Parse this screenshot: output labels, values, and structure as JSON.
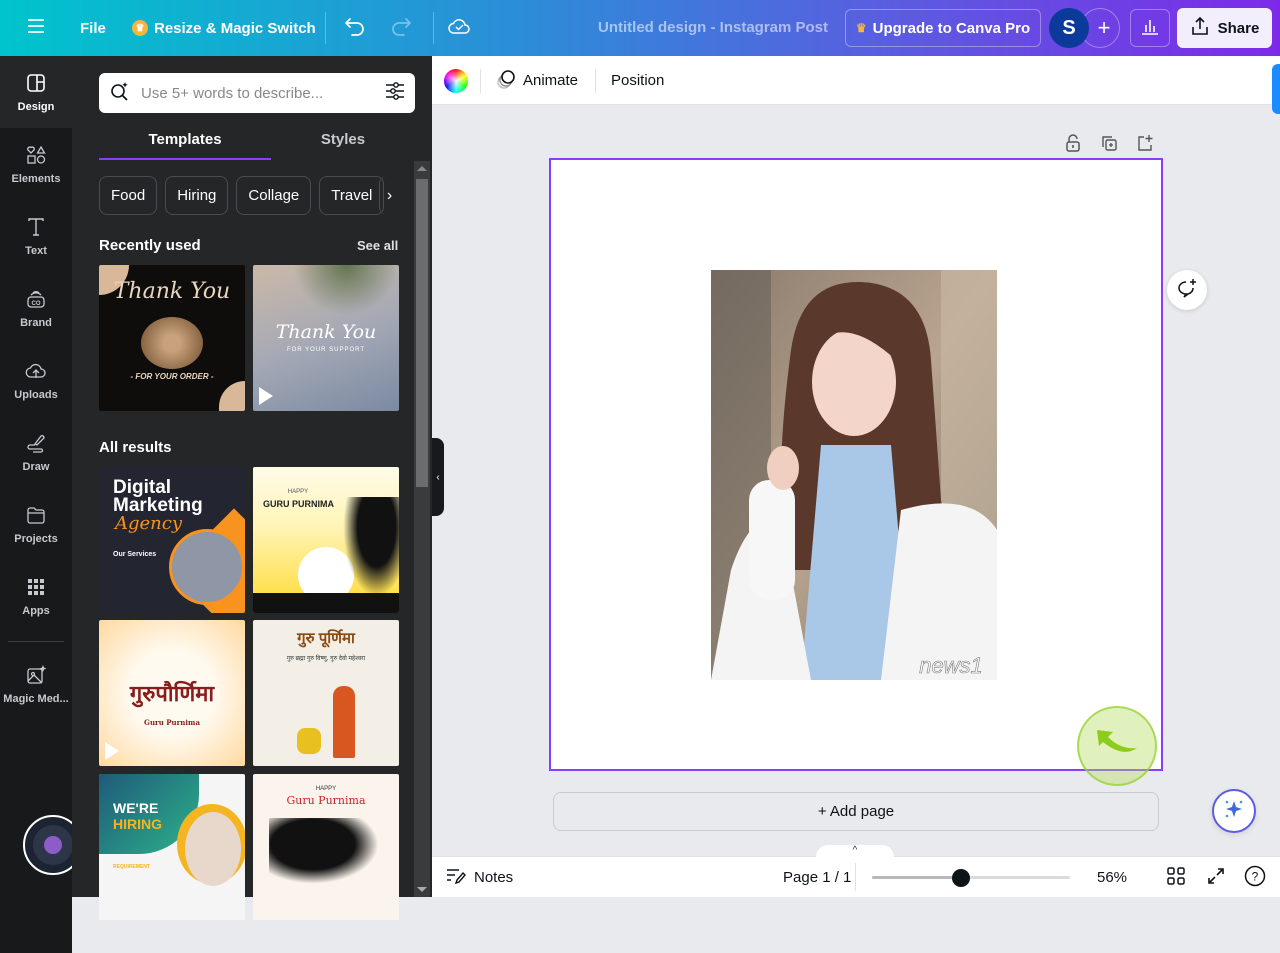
{
  "topbar": {
    "menu_icon": "hamburger-icon",
    "file_label": "File",
    "resize_label": "Resize & Magic Switch",
    "undo_icon": "undo-icon",
    "redo_icon": "redo-icon",
    "save_status_icon": "cloud-check-icon",
    "document_title": "Untitled design - Instagram Post",
    "upgrade_label": "Upgrade to Canva Pro",
    "avatar_initial": "S",
    "add_collaborator_icon": "plus-icon",
    "insights_icon": "bar-chart-icon",
    "share_label": "Share",
    "colors": {
      "crown": "#f6b53b",
      "avatar_bg": "#0b3a9a"
    }
  },
  "rail": {
    "items": [
      {
        "label": "Design",
        "icon": "design-layout-icon",
        "active": true
      },
      {
        "label": "Elements",
        "icon": "elements-shapes-icon",
        "active": false
      },
      {
        "label": "Text",
        "icon": "text-t-icon",
        "active": false
      },
      {
        "label": "Brand",
        "icon": "brand-icon",
        "active": false
      },
      {
        "label": "Uploads",
        "icon": "cloud-upload-icon",
        "active": false
      },
      {
        "label": "Draw",
        "icon": "draw-pen-icon",
        "active": false
      },
      {
        "label": "Projects",
        "icon": "folder-icon",
        "active": false
      },
      {
        "label": "Apps",
        "icon": "apps-grid-icon",
        "active": false
      },
      {
        "label": "Magic Med...",
        "icon": "magic-media-icon",
        "active": false
      }
    ]
  },
  "panel": {
    "search_placeholder": "Use 5+ words to describe...",
    "tabs": [
      {
        "label": "Templates",
        "active": true
      },
      {
        "label": "Styles",
        "active": false
      }
    ],
    "chips": [
      "Food",
      "Hiring",
      "Collage",
      "Travel"
    ],
    "recently_used_title": "Recently used",
    "see_all_label": "See all",
    "recently_used": [
      {
        "title": "Thank You",
        "subtitle": "- FOR YOUR ORDER -",
        "video": false
      },
      {
        "title": "Thank You",
        "subtitle": "FOR YOUR SUPPORT",
        "video": true
      }
    ],
    "all_results_title": "All results",
    "all_results": [
      {
        "title": "Digital Marketing",
        "subtitle": "Agency",
        "extra": "Our Services",
        "video": false
      },
      {
        "title": "GURU PURNIMA",
        "subtitle": "HAPPY",
        "video": false
      },
      {
        "title": "गुरुपौर्णिमा",
        "subtitle": "Guru Purnima",
        "video": true
      },
      {
        "title": "गुरु पूर्णिमा",
        "subtitle": "गुरु ब्रह्मा गुरु विष्णु, गुरु देवो महेश्वरा",
        "video": false
      },
      {
        "title": "WE'RE",
        "subtitle": "HIRING",
        "extra": "REQUIREMENT",
        "video": false
      },
      {
        "title": "Guru Purnima",
        "subtitle": "HAPPY",
        "video": false
      }
    ]
  },
  "context_bar": {
    "color_icon": "color-wheel-icon",
    "animate_label": "Animate",
    "position_label": "Position"
  },
  "canvas": {
    "photo_watermark": "news1",
    "add_page_label": "+ Add page",
    "page_tools": [
      "lock-icon",
      "duplicate-page-icon",
      "add-page-icon"
    ],
    "selection_color": "#8b3dff"
  },
  "footer": {
    "notes_label": "Notes",
    "page_indicator": "Page 1 / 1",
    "zoom_percent": 56,
    "zoom_label": "56%",
    "zoom_fraction": 0.45,
    "grid_view_icon": "grid-view-icon",
    "fullscreen_icon": "fullscreen-icon",
    "help_icon": "help-icon"
  }
}
